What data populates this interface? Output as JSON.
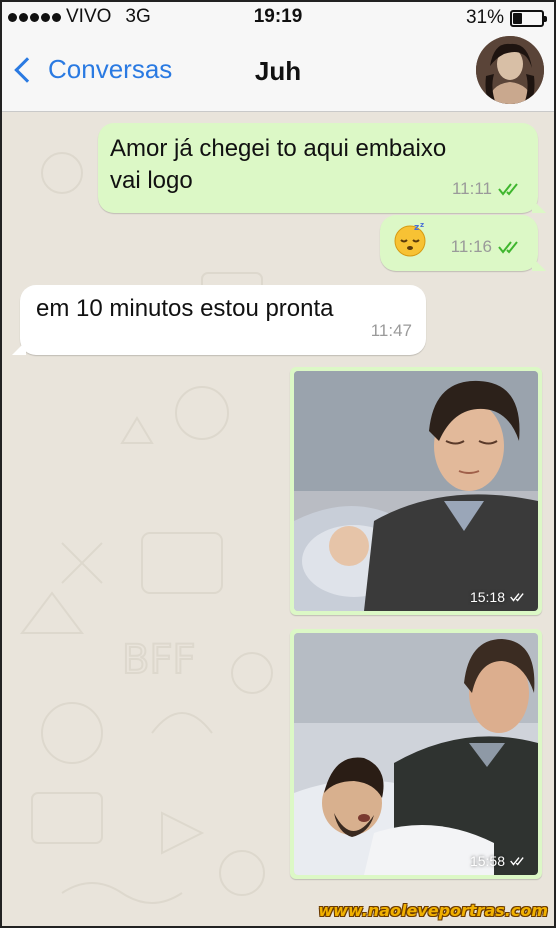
{
  "status_bar": {
    "carrier": "VIVO",
    "network": "3G",
    "time": "19:19",
    "battery_percent": "31%",
    "battery_level": 0.31
  },
  "nav": {
    "back_label": "Conversas",
    "contact_name": "Juh"
  },
  "messages": [
    {
      "direction": "out",
      "lines": [
        "Amor já chegei to aqui embaixo",
        "vai logo"
      ],
      "time": "11:11",
      "status": "read"
    },
    {
      "direction": "out",
      "emoji": "😴",
      "time": "11:16",
      "status": "read"
    },
    {
      "direction": "in",
      "lines": [
        "em 10 minutos estou pronta"
      ],
      "time": "11:47"
    },
    {
      "direction": "out",
      "type": "image",
      "time": "15:18",
      "status": "delivered"
    },
    {
      "direction": "out",
      "type": "image",
      "time": "15:58",
      "status": "delivered"
    }
  ],
  "watermark": "www.naoleveportras.com",
  "colors": {
    "outgoing_bubble": "#dcf8c6",
    "incoming_bubble": "#ffffff",
    "accent": "#2a7ae2",
    "read_ticks": "#34b7f1"
  }
}
